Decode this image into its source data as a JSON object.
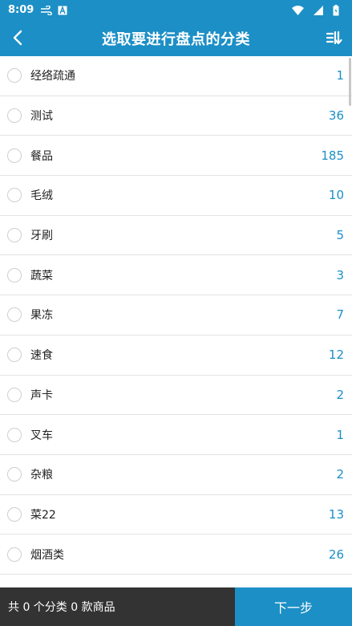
{
  "status_bar": {
    "time": "8:09",
    "colors": {
      "background": "#1c8fc6"
    }
  },
  "app_bar": {
    "title": "选取要进行盘点的分类",
    "back_icon": "chevron-left-icon",
    "sort_icon": "sort-icon"
  },
  "categories": [
    {
      "name": "经络疏通",
      "count": "1"
    },
    {
      "name": "测试",
      "count": "36"
    },
    {
      "name": "餐品",
      "count": "185"
    },
    {
      "name": "毛绒",
      "count": "10"
    },
    {
      "name": "牙刷",
      "count": "5"
    },
    {
      "name": "蔬菜",
      "count": "3"
    },
    {
      "name": "果冻",
      "count": "7"
    },
    {
      "name": "速食",
      "count": "12"
    },
    {
      "name": "声卡",
      "count": "2"
    },
    {
      "name": "叉车",
      "count": "1"
    },
    {
      "name": "杂粮",
      "count": "2"
    },
    {
      "name": "菜22",
      "count": "13"
    },
    {
      "name": "烟酒类",
      "count": "26"
    }
  ],
  "bottom_bar": {
    "summary": "共 0 个分类 0 款商品",
    "next_label": "下一步"
  },
  "colors": {
    "accent": "#1c8fc6",
    "bottom_dark": "#333333"
  }
}
